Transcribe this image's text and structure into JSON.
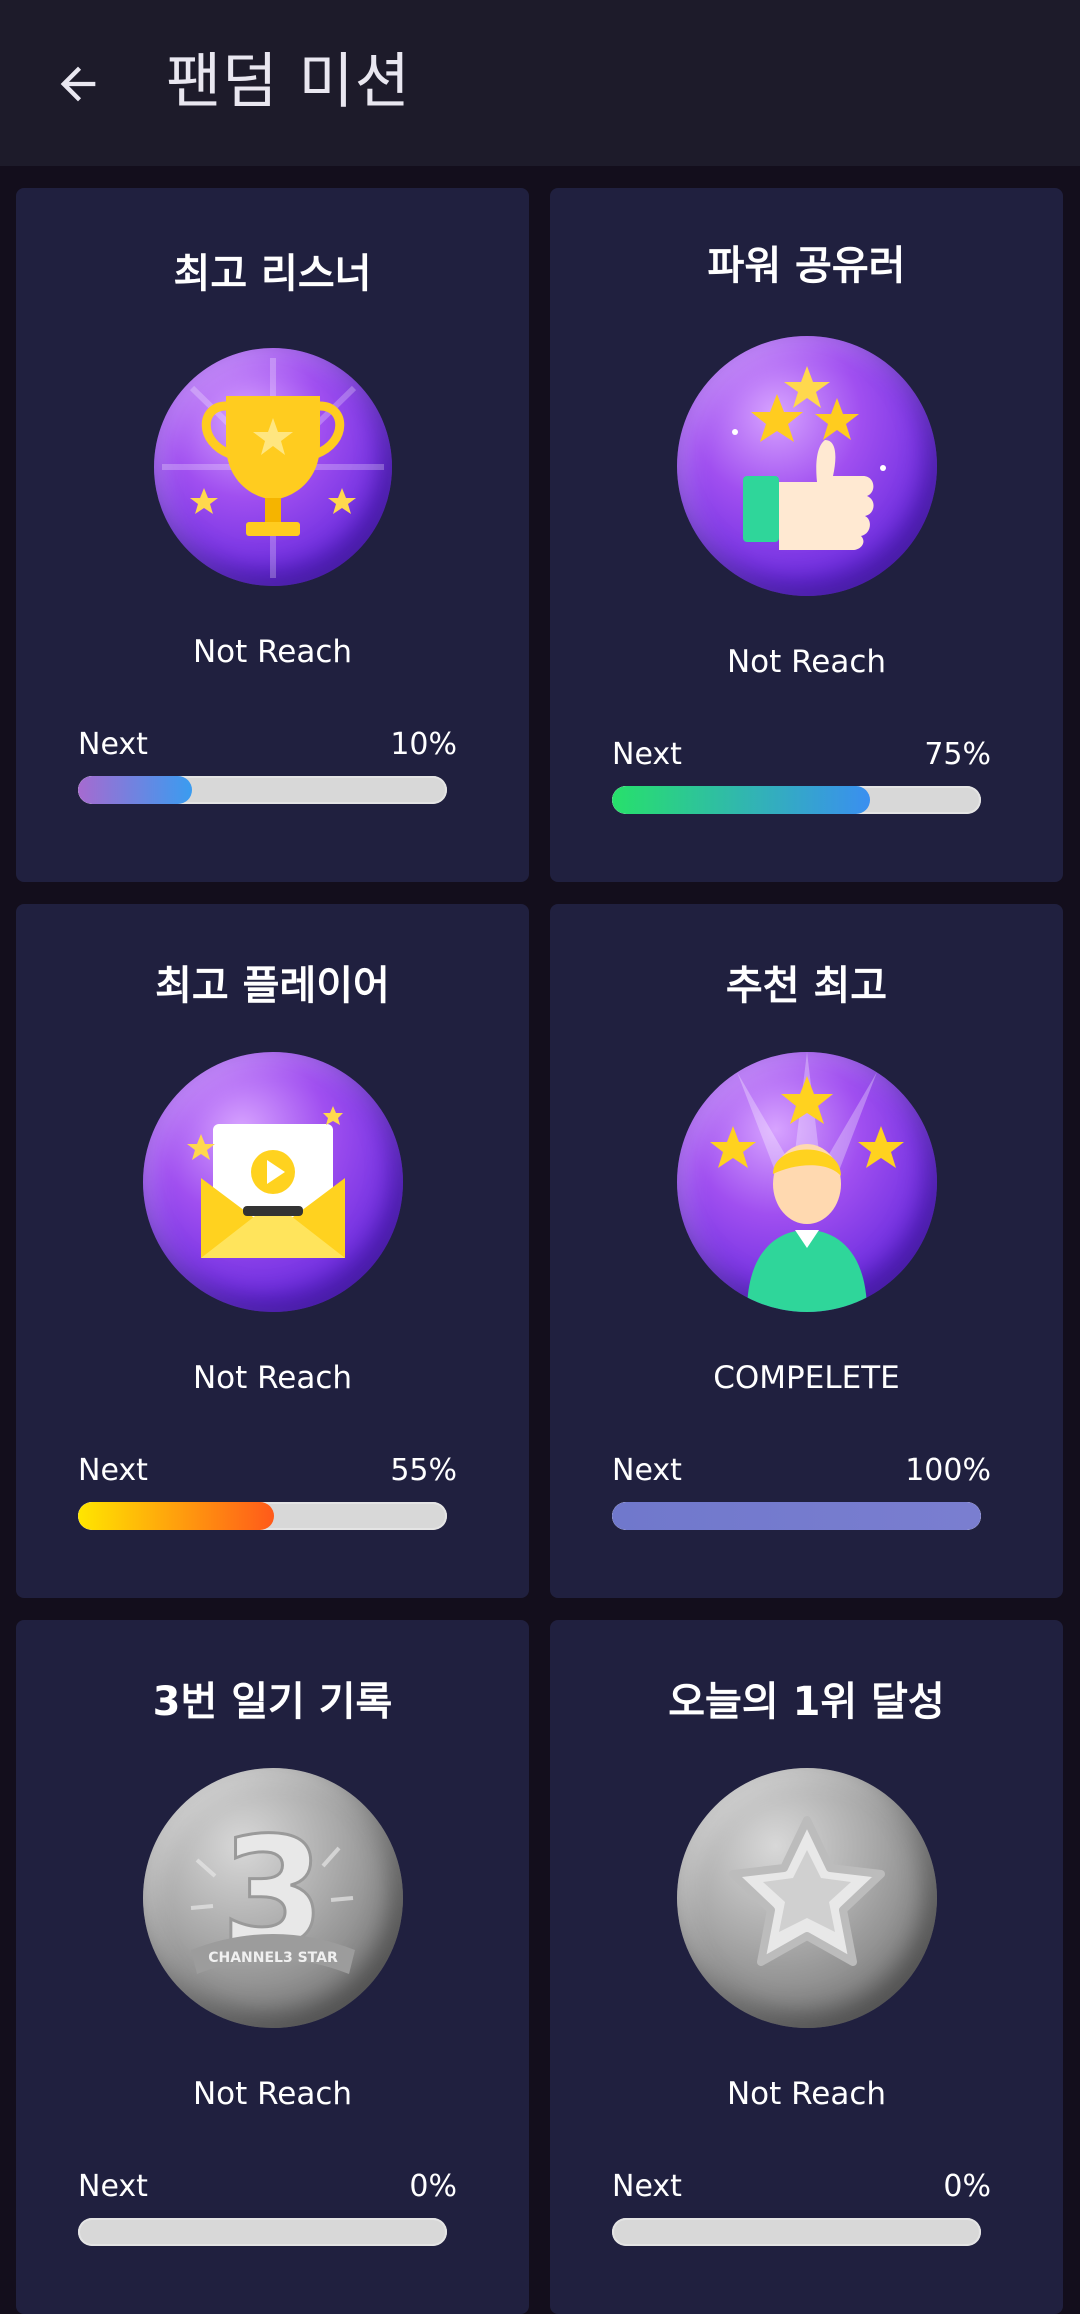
{
  "header": {
    "title": "팬덤 미션",
    "back_icon": "arrow-left-icon"
  },
  "missions": [
    {
      "title": "최고 리스너",
      "icon": "trophy-icon",
      "status": "Not Reach",
      "next_label": "Next",
      "percent_label": "10%",
      "progress": 0.31,
      "fill_colors": [
        "#a66ad0",
        "#3a9cf0"
      ]
    },
    {
      "title": "파워 공유러",
      "icon": "thumbs-up-stars-icon",
      "status": "Not Reach",
      "next_label": "Next",
      "percent_label": "75%",
      "progress": 0.7,
      "fill_colors": [
        "#27e06b",
        "#3a8ff0"
      ]
    },
    {
      "title": "최고 플레이어",
      "icon": "video-mail-icon",
      "status": "Not Reach",
      "next_label": "Next",
      "percent_label": "55%",
      "progress": 0.53,
      "fill_colors": [
        "#ffe600",
        "#ff5a1a"
      ]
    },
    {
      "title": "추천 최고",
      "icon": "person-stars-icon",
      "status": "COMPELETE",
      "next_label": "Next",
      "percent_label": "100%",
      "progress": 1.0,
      "fill_colors": [
        "#7078cc",
        "#7a7ed0"
      ]
    },
    {
      "title": "3번 일기 기록",
      "icon": "number-three-badge-icon",
      "status": "Not Reach",
      "next_label": "Next",
      "percent_label": "0%",
      "progress": 0,
      "fill_colors": [
        "#d8d8d8",
        "#d8d8d8"
      ],
      "badge_text": "CHANNEL3 STAR"
    },
    {
      "title": "오늘의 1위 달성",
      "icon": "star-icon",
      "status": "Not Reach",
      "next_label": "Next",
      "percent_label": "0%",
      "progress": 0,
      "fill_colors": [
        "#d8d8d8",
        "#d8d8d8"
      ]
    }
  ]
}
